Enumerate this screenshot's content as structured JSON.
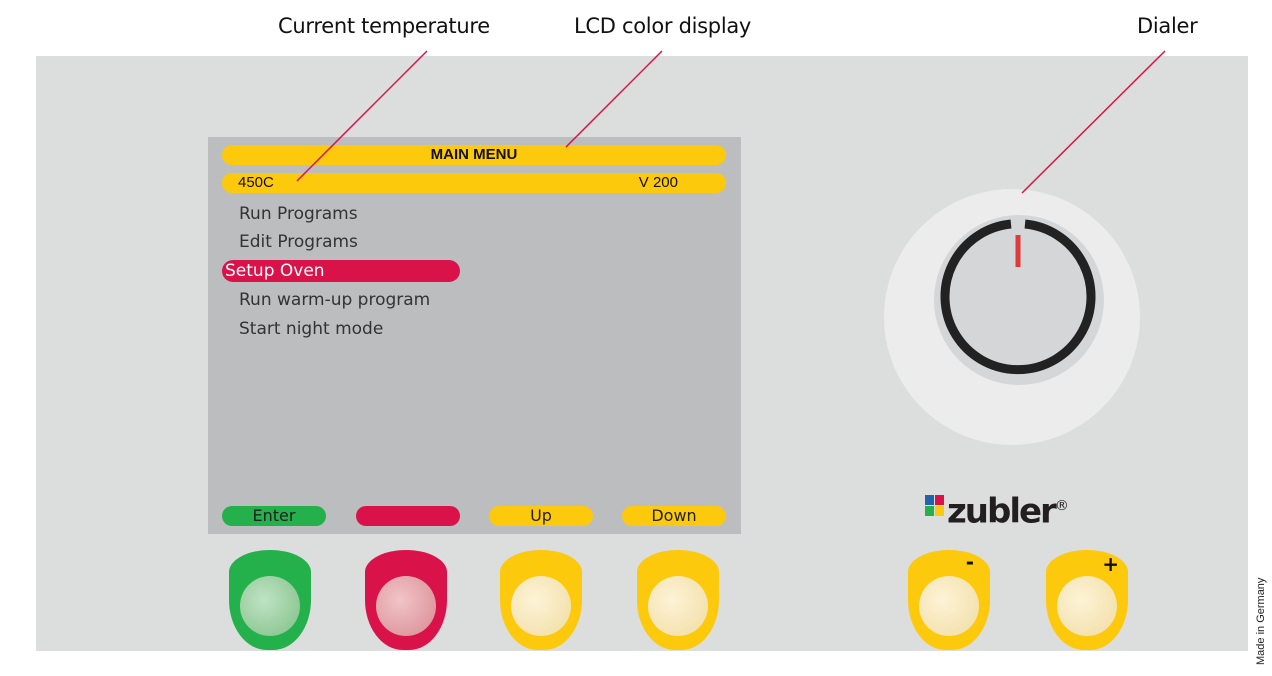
{
  "callouts": {
    "current_temperature": "Current temperature",
    "lcd_display": "LCD color display",
    "dialer": "Dialer"
  },
  "lcd": {
    "header": "MAIN MENU",
    "temperature": "450C",
    "version": "V 200",
    "menu_items": [
      "Run Programs",
      "Edit Programs",
      "Setup Oven",
      "Run warm-up program",
      "Start night mode"
    ],
    "selected_item": "Setup Oven",
    "softkeys": [
      "Enter",
      "",
      "Up",
      "Down"
    ]
  },
  "controls": {
    "minus_label": "-",
    "plus_label": "+"
  },
  "brand": {
    "name": "zubler",
    "registered": "®"
  },
  "footer": {
    "made_in": "Made in Germany"
  },
  "colors": {
    "panel": "#dcdddd",
    "lcd_background": "#bcbdbf",
    "yellow": "#fdc90c",
    "red": "#d9134a",
    "green": "#24b04b",
    "callout_line": "#d9134a"
  }
}
